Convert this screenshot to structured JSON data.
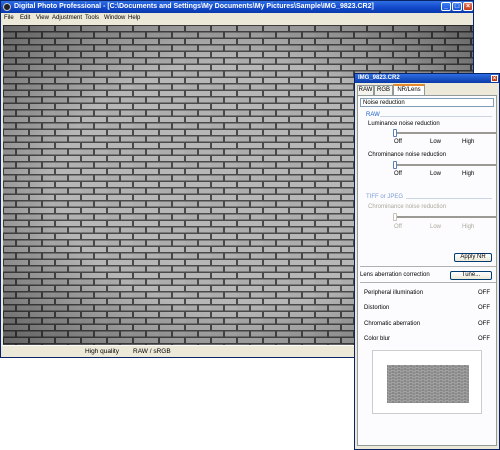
{
  "window": {
    "title": "Digital Photo Professional - [C:\\Documents and Settings\\My Documents\\My Pictures\\Sample\\IMG_9823.CR2]"
  },
  "menu": [
    "File",
    "Edit",
    "View",
    "Adjustment",
    "Tools",
    "Window",
    "Help"
  ],
  "status": {
    "quality": "High quality",
    "color_space": "RAW / sRGB"
  },
  "palette": {
    "title": "IMG_9823.CR2",
    "tabs": [
      "RAW",
      "RGB",
      "NR/Lens"
    ],
    "active_tab": "NR/Lens",
    "noise_reduction": {
      "header": "Noise reduction",
      "raw_group": "RAW",
      "luminance_label": "Luminance noise reduction",
      "luminance_value": 0,
      "chrominance_label": "Chrominance noise reduction",
      "chrominance_value": 0,
      "tiff_group": "TIFF or JPEG",
      "tiff_label": "Chrominance noise reduction",
      "tiff_value": 0,
      "ticks": [
        "Off",
        "Low",
        "High"
      ],
      "apply_button": "Apply NR"
    },
    "lens": {
      "header": "Lens aberration correction",
      "tune_button": "Tune...",
      "rows": [
        {
          "name": "Peripheral illumination",
          "value": "OFF"
        },
        {
          "name": "Distortion",
          "value": "OFF"
        },
        {
          "name": "Chromatic aberration",
          "value": "OFF"
        },
        {
          "name": "Color blur",
          "value": "OFF"
        }
      ]
    }
  },
  "colors": {
    "titlebar": "#0a3aa9",
    "brick": "#b7b7b7",
    "mortar": "#4a4a4a",
    "group_label": "#1c5fc7",
    "active_tab_accent": "#e68b2c"
  }
}
